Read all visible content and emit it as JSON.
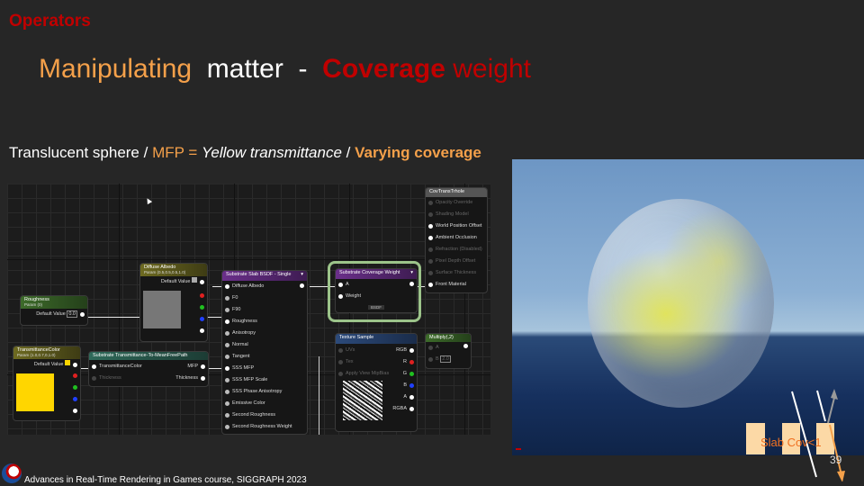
{
  "section_label": "Operators",
  "title": {
    "part1": "Manipulating",
    "part2": "matter",
    "part3": "-",
    "part4": "Coverage",
    "part5": "weight"
  },
  "subtitle": {
    "a": "Translucent sphere / ",
    "b": "MFP = ",
    "c": "Yellow transmittance",
    "a2": " / ",
    "d": "Varying coverage"
  },
  "graph": {
    "nodes": {
      "roughness": {
        "title": "Roughness",
        "sub": "Param (0)",
        "pin": "Default Value",
        "value": "0.0"
      },
      "diffuse_albedo": {
        "title": "Diffuse Albedo",
        "sub": "Param (0.5,0.5,0.5,1.0)",
        "pin": "Default Value"
      },
      "transmittance_color": {
        "title": "TransmittanceColor",
        "sub": "Param (1.0,0.7,0,1.0)",
        "pin": "Default Value"
      },
      "transmittance_to_mfp": {
        "title": "Substrate Transmittance-To-MeanFreePath",
        "inputs": [
          "TransmittanceColor",
          "Thickness"
        ],
        "outputs": [
          "MFP",
          "Thickness"
        ]
      },
      "slab_bsdf": {
        "title": "Substrate Slab BSDF - Single",
        "inputs": [
          "Diffuse Albedo",
          "F0",
          "F90",
          "Roughness",
          "Anisotropy",
          "Normal",
          "Tangent",
          "SSS MFP",
          "SSS MFP Scale",
          "SSS Phase Anisotropy",
          "Emissive Color",
          "Second Roughness",
          "Second Roughness Weight"
        ]
      },
      "coverage_weight": {
        "title": "Substrate Coverage Weight",
        "inputs": [
          "A",
          "Weight"
        ],
        "tag": "BSDF"
      },
      "texture_sample": {
        "title": "Texture Sample",
        "inputs": [
          "UVs",
          "Tex",
          "Apply View MipBias"
        ],
        "outputs": [
          "RGB",
          "R",
          "G",
          "B",
          "A",
          "RGBA"
        ]
      },
      "multiply": {
        "title": "Multiply(,2)",
        "inputs": [
          "A",
          "B"
        ],
        "b_value": "2.0"
      },
      "material": {
        "title": "CovTransTrhole",
        "inputs": [
          "Opacity Override",
          "Shading Model",
          "World Position Offset",
          "Ambient Occlusion",
          "Refraction (Disabled)",
          "Pixel Depth Offset",
          "Surface Thickness",
          "Front Material"
        ],
        "dim": [
          true,
          true,
          false,
          false,
          true,
          true,
          true,
          false
        ]
      }
    }
  },
  "render": {
    "slab_label": "Slab Cov<1"
  },
  "page_number": "39",
  "footer_text": "Advances in Real-Time Rendering in Games course, SIGGRAPH  2023",
  "colors": {
    "accent_red": "#c00000",
    "accent_orange": "#f4a04a",
    "background": "#262626"
  }
}
